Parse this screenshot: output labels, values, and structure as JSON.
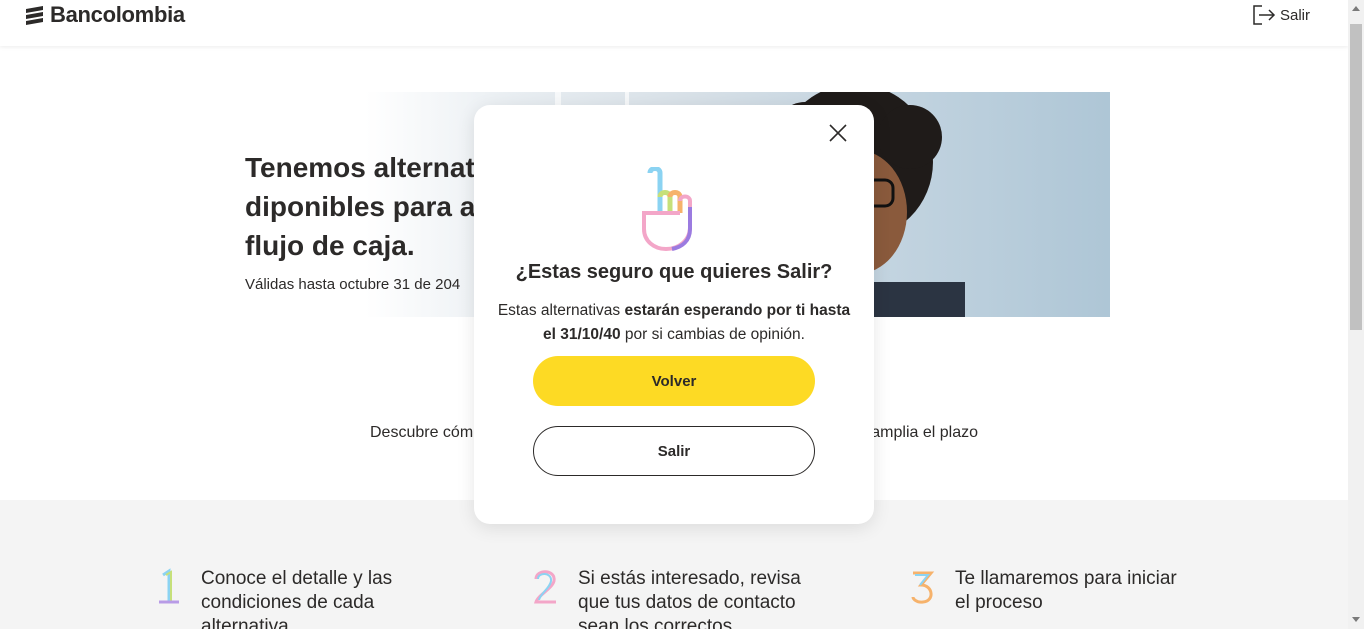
{
  "header": {
    "brand": "Bancolombia",
    "exit_label": "Salir",
    "icons": {
      "logo": "bancolombia-logo-icon",
      "exit": "exit-icon"
    }
  },
  "hero": {
    "title": "Tenemos alternat diponibles para a flujo de caja.",
    "title_lines": [
      "Tenemos alternat",
      "diponibles para a",
      "flujo de caja."
    ],
    "subtitle": "Válidas hasta octubre 31 de 204"
  },
  "discover": {
    "left": "Descubre cóm",
    "right": "amplia el plazo"
  },
  "steps": [
    {
      "number": "1",
      "text": "Conoce el detalle y las condiciones de cada alternativa"
    },
    {
      "number": "2",
      "text": "Si estás interesado, revisa que tus datos de contacto sean los correctos"
    },
    {
      "number": "3",
      "text": "Te llamaremos para iniciar el proceso"
    }
  ],
  "modal": {
    "title": "¿Estas seguro que quieres Salir?",
    "body_prefix": "Estas alternativas ",
    "body_bold": "estarán esperando por ti hasta el 31/10/40",
    "body_suffix": " por si cambias de opinión.",
    "primary_button": "Volver",
    "secondary_button": "Salir",
    "icons": {
      "close": "close-icon",
      "hero": "raised-hand-icon"
    }
  },
  "colors": {
    "brand_yellow": "#fdda24",
    "text_dark": "#2c2a29",
    "band_gray": "#f4f4f4"
  }
}
